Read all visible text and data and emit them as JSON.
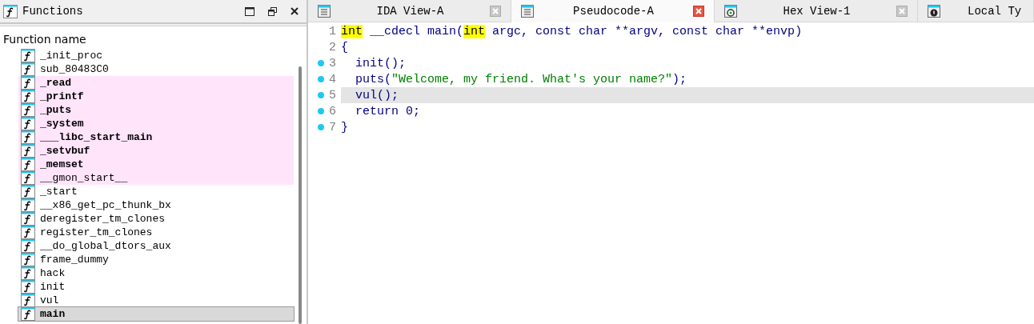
{
  "functions_panel": {
    "title": "Functions",
    "column_header": "Function name",
    "rows": [
      {
        "name": "_init_proc",
        "imported": false,
        "bold": false,
        "selected": false
      },
      {
        "name": "sub_80483C0",
        "imported": false,
        "bold": false,
        "selected": false
      },
      {
        "name": "_read",
        "imported": true,
        "bold": true,
        "selected": false
      },
      {
        "name": "_printf",
        "imported": true,
        "bold": true,
        "selected": false
      },
      {
        "name": "_puts",
        "imported": true,
        "bold": true,
        "selected": false
      },
      {
        "name": "_system",
        "imported": true,
        "bold": true,
        "selected": false
      },
      {
        "name": "___libc_start_main",
        "imported": true,
        "bold": true,
        "selected": false
      },
      {
        "name": "_setvbuf",
        "imported": true,
        "bold": true,
        "selected": false
      },
      {
        "name": "_memset",
        "imported": true,
        "bold": true,
        "selected": false
      },
      {
        "name": "__gmon_start__",
        "imported": true,
        "bold": false,
        "selected": false
      },
      {
        "name": "_start",
        "imported": false,
        "bold": false,
        "selected": false
      },
      {
        "name": "__x86_get_pc_thunk_bx",
        "imported": false,
        "bold": false,
        "selected": false
      },
      {
        "name": "deregister_tm_clones",
        "imported": false,
        "bold": false,
        "selected": false
      },
      {
        "name": "register_tm_clones",
        "imported": false,
        "bold": false,
        "selected": false
      },
      {
        "name": "__do_global_dtors_aux",
        "imported": false,
        "bold": false,
        "selected": false
      },
      {
        "name": "frame_dummy",
        "imported": false,
        "bold": false,
        "selected": false
      },
      {
        "name": "hack",
        "imported": false,
        "bold": false,
        "selected": false
      },
      {
        "name": "init",
        "imported": false,
        "bold": false,
        "selected": false
      },
      {
        "name": "vul",
        "imported": false,
        "bold": false,
        "selected": false
      },
      {
        "name": "main",
        "imported": false,
        "bold": true,
        "selected": true
      }
    ]
  },
  "tabs": [
    {
      "label": "IDA View-A",
      "kind": "listing",
      "selected": false
    },
    {
      "label": "Pseudocode-A",
      "kind": "listing",
      "selected": true
    },
    {
      "label": "Hex View-1",
      "kind": "hex",
      "selected": false
    },
    {
      "label": "Local Ty",
      "kind": "info",
      "selected": false
    }
  ],
  "code": [
    {
      "number": "1",
      "breakpoint": false,
      "current": false,
      "tokens": [
        {
          "kind": "type",
          "text": "int"
        },
        {
          "kind": "code",
          "text": " __cdecl main("
        },
        {
          "kind": "type",
          "text": "int"
        },
        {
          "kind": "code",
          "text": " argc, const char **argv, const char **envp)"
        }
      ]
    },
    {
      "number": "2",
      "breakpoint": false,
      "current": false,
      "tokens": [
        {
          "kind": "code",
          "text": "{"
        }
      ]
    },
    {
      "number": "3",
      "breakpoint": true,
      "current": false,
      "tokens": [
        {
          "kind": "code",
          "text": "  init();"
        }
      ]
    },
    {
      "number": "4",
      "breakpoint": true,
      "current": false,
      "tokens": [
        {
          "kind": "code",
          "text": "  puts("
        },
        {
          "kind": "string",
          "text": "\"Welcome, my friend. What's your name?\""
        },
        {
          "kind": "code",
          "text": ");"
        }
      ]
    },
    {
      "number": "5",
      "breakpoint": true,
      "current": true,
      "tokens": [
        {
          "kind": "code",
          "text": "  vul();"
        }
      ]
    },
    {
      "number": "6",
      "breakpoint": true,
      "current": false,
      "tokens": [
        {
          "kind": "code",
          "text": "  return 0;"
        }
      ]
    },
    {
      "number": "7",
      "breakpoint": true,
      "current": false,
      "tokens": [
        {
          "kind": "code",
          "text": "}"
        }
      ]
    }
  ]
}
